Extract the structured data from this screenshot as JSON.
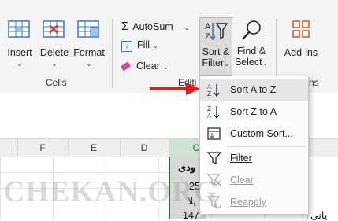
{
  "ribbon": {
    "cells_group": {
      "label": "Cells",
      "insert": "Insert",
      "delete": "Delete",
      "format": "Format"
    },
    "editing_group": {
      "label_visible": "Editi",
      "autosum": "AutoSum",
      "fill": "Fill",
      "clear": "Clear",
      "sort_filter_line1": "Sort &",
      "sort_filter_line2": "Filter",
      "find_select_line1": "Find &",
      "find_select_line2": "Select"
    },
    "addins": "Add-ins",
    "next_group_partial": "ns"
  },
  "grid": {
    "columns": [
      "F",
      "E",
      "D",
      "C"
    ],
    "cells": {
      "header_partial": "ودی",
      "r1": "25",
      "r2": "پلا",
      "r3": "147",
      "r3_text": "یانی"
    }
  },
  "sort_menu": {
    "items": [
      {
        "label": "Sort A to Z",
        "icon": "sort-a-to-z-icon",
        "state": "hover"
      },
      {
        "label": "Sort Z to A",
        "icon": "sort-z-to-a-icon",
        "state": "enabled"
      },
      {
        "label": "Custom Sort...",
        "icon": "custom-sort-icon",
        "state": "enabled"
      },
      {
        "label": "Filter",
        "icon": "filter-icon",
        "state": "enabled"
      },
      {
        "label": "Clear",
        "icon": "clear-filter-icon",
        "state": "disabled"
      },
      {
        "label": "Reapply",
        "icon": "reapply-icon",
        "state": "disabled"
      }
    ]
  },
  "annotation": {
    "arrow_color": "#e31b1b"
  },
  "watermark": {
    "text": "CHEKAN.ORG"
  }
}
